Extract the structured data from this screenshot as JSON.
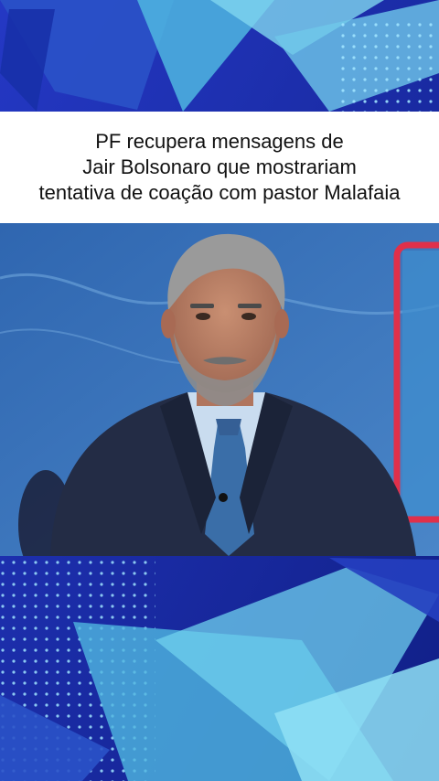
{
  "post": {
    "headline_lines": [
      "PF recupera mensagens de",
      "Jair Bolsonaro que mostrariam",
      "tentativa de coação com pastor Malafaia"
    ]
  },
  "colors": {
    "background_blue": "#1a2a9a",
    "accent_cyan": "#5fd0e6",
    "studio_blue": "#3b72b6",
    "accent_red": "#e0304a",
    "headline_bg": "#ffffff",
    "headline_text": "#111111"
  },
  "video": {
    "scene": "news-anchor-studio"
  }
}
